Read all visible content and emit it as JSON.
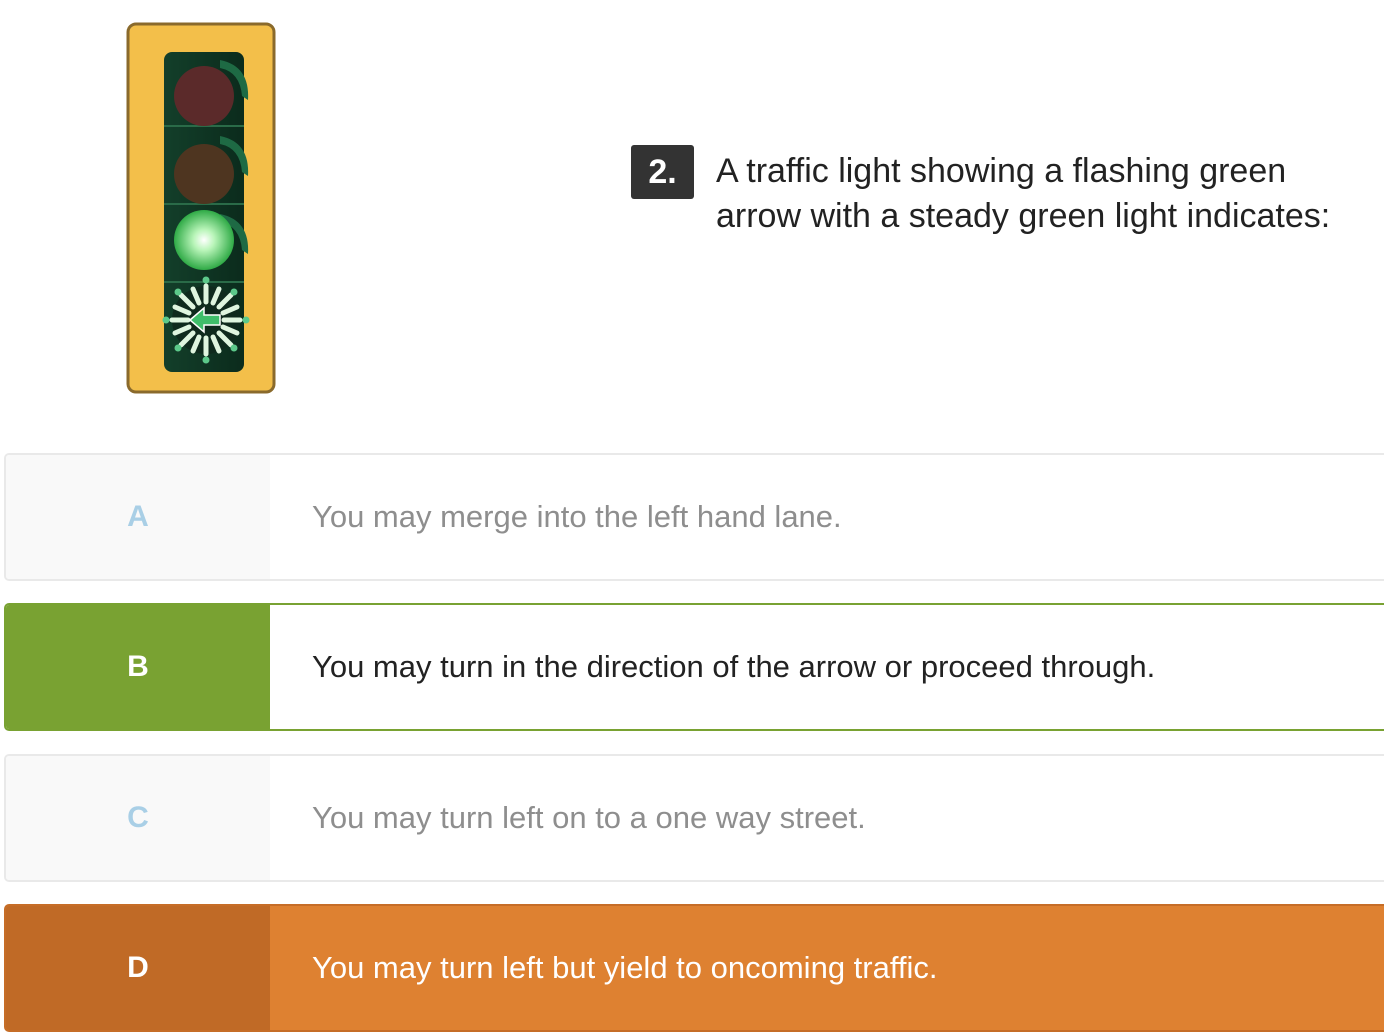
{
  "question": {
    "number": "2.",
    "text": "A traffic light showing a flashing green arrow with a steady green light indicates:"
  },
  "illustration": {
    "icon": "traffic-light-flashing-green-arrow-icon",
    "housing_color": "#f3bf4a"
  },
  "answers": [
    {
      "letter": "A",
      "text": "You may merge into the left hand lane.",
      "state": "default"
    },
    {
      "letter": "B",
      "text": "You may turn in the direction of the arrow or proceed through.",
      "state": "correct"
    },
    {
      "letter": "C",
      "text": "You may turn left on to a one way street.",
      "state": "default"
    },
    {
      "letter": "D",
      "text": "You may turn left but yield to oncoming traffic.",
      "state": "incorrect"
    }
  ],
  "colors": {
    "correct": "#79a232",
    "incorrect": "#de8131",
    "letter_default": "#a9cfe6"
  }
}
